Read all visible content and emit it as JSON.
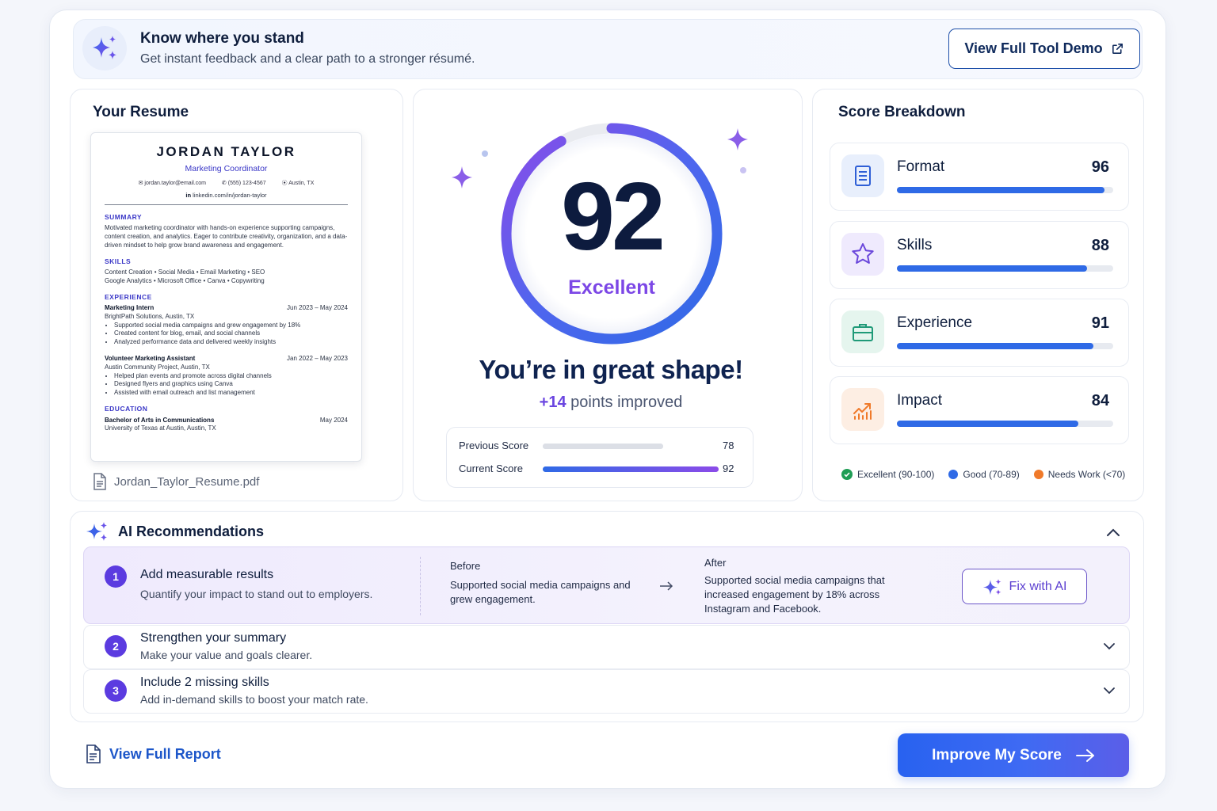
{
  "banner": {
    "title": "Know where you stand",
    "subtitle": "Get instant feedback and a clear path to a stronger résumé.",
    "demo_button": "View Full Tool Demo"
  },
  "resume_card": {
    "title": "Your Resume",
    "file_name": "Jordan_Taylor_Resume.pdf",
    "doc": {
      "name": "JORDAN TAYLOR",
      "role": "Marketing Coordinator",
      "email": "jordan.taylor@email.com",
      "phone": "(555) 123-4567",
      "location": "Austin, TX",
      "linkedin": "linkedin.com/in/jordan-taylor",
      "summary_heading": "SUMMARY",
      "summary": "Motivated marketing coordinator with hands-on experience supporting campaigns, content creation, and analytics. Eager to contribute creativity, organization, and a data-driven mindset to help grow brand awareness and engagement.",
      "skills_heading": "SKILLS",
      "skills_line1": "Content Creation  •  Social Media  •  Email Marketing  •  SEO",
      "skills_line2": "Google Analytics  •  Microsoft Office  •  Canva  •  Copywriting",
      "experience_heading": "EXPERIENCE",
      "job1_title": "Marketing Intern",
      "job1_dates": "Jun 2023 – May 2024",
      "job1_company": "BrightPath Solutions, Austin, TX",
      "job1_b1": "Supported social media campaigns and grew engagement by 18%",
      "job1_b2": "Created content for blog, email, and social channels",
      "job1_b3": "Analyzed performance data and delivered weekly insights",
      "job2_title": "Volunteer Marketing Assistant",
      "job2_dates": "Jan 2022 – May 2023",
      "job2_company": "Austin Community Project, Austin, TX",
      "job2_b1": "Helped plan events and promote across digital channels",
      "job2_b2": "Designed flyers and graphics using Canva",
      "job2_b3": "Assisted with email outreach and list management",
      "education_heading": "EDUCATION",
      "degree": "Bachelor of Arts in Communications",
      "degree_date": "May 2024",
      "school": "University of Texas at Austin, Austin, TX"
    }
  },
  "score": {
    "value": "92",
    "label": "Excellent",
    "progress_fraction": 0.92,
    "headline": "You’re in great shape!",
    "delta": "+14",
    "delta_text": "points improved",
    "previous_label": "Previous Score",
    "previous_value": "78",
    "previous_fraction": 0.78,
    "current_label": "Current Score",
    "current_value": "92",
    "current_fraction": 0.92
  },
  "breakdown": {
    "title": "Score Breakdown",
    "items": [
      {
        "name": "Format",
        "score": "96",
        "fraction": 0.96,
        "icon": "document-icon"
      },
      {
        "name": "Skills",
        "score": "88",
        "fraction": 0.88,
        "icon": "star-icon"
      },
      {
        "name": "Experience",
        "score": "91",
        "fraction": 0.91,
        "icon": "briefcase-icon"
      },
      {
        "name": "Impact",
        "score": "84",
        "fraction": 0.84,
        "icon": "growth-chart-icon"
      }
    ],
    "legend": [
      {
        "label": "Excellent (90-100)",
        "color": "#1f9d55"
      },
      {
        "label": "Good (70-89)",
        "color": "#2f6ae6"
      },
      {
        "label": "Needs Work (<70)",
        "color": "#f07a2a"
      }
    ]
  },
  "recommendations": {
    "title": "AI Recommendations",
    "items": [
      {
        "number": "1",
        "title": "Add measurable results",
        "subtitle": "Quantify your impact to stand out to employers.",
        "before_label": "Before",
        "before_text": "Supported social media campaigns and grew engagement.",
        "after_label": "After",
        "after_text": "Supported social media campaigns that increased engagement by 18% across Instagram and Facebook.",
        "action": "Fix with AI"
      },
      {
        "number": "2",
        "title": "Strengthen your summary",
        "subtitle": "Make your value and goals clearer."
      },
      {
        "number": "3",
        "title": "Include 2 missing skills",
        "subtitle": "Add in-demand skills to boost your match rate."
      }
    ]
  },
  "footer": {
    "report_link": "View Full Report",
    "cta": "Improve My Score"
  },
  "colors": {
    "accent_blue": "#2f6ae6",
    "accent_purple": "#7c47e6",
    "navy": "#0f1e3d"
  }
}
